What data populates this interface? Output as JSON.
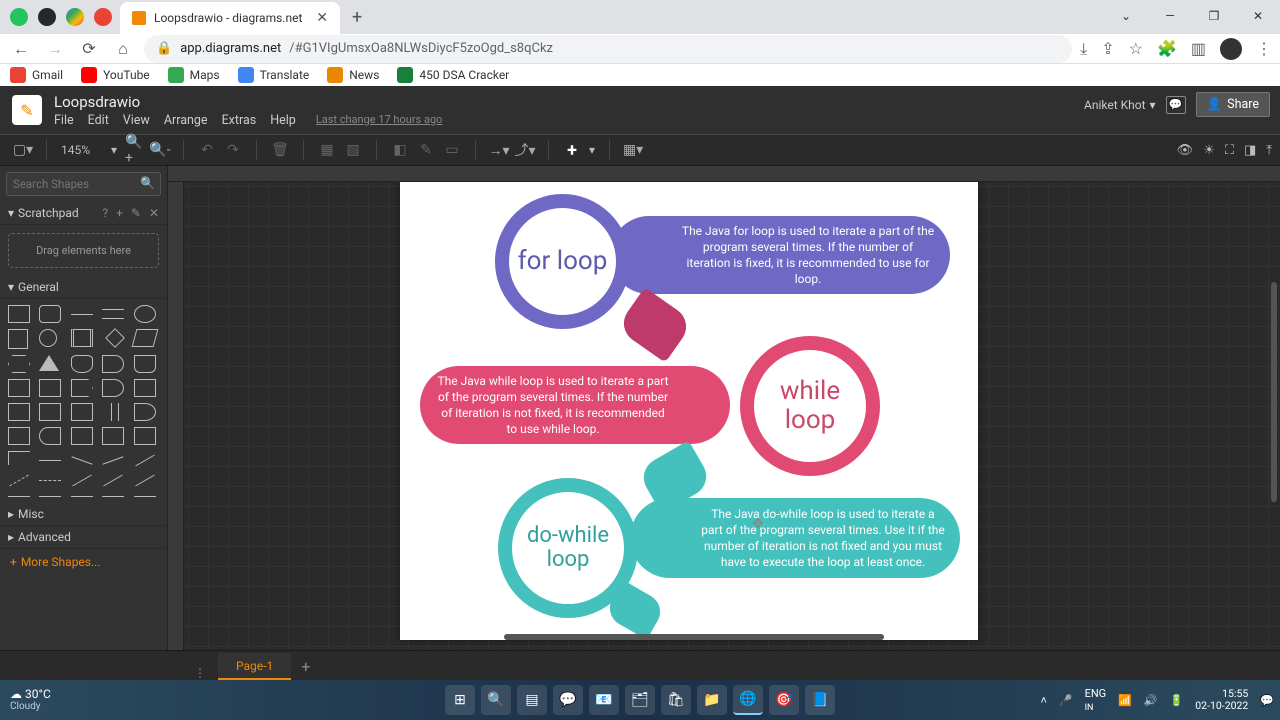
{
  "browser": {
    "tab_title": "Loopsdrawio - diagrams.net",
    "url_host": "app.diagrams.net",
    "url_path": "/#G1VIgUmsxOa8NLWsDiycF5zoOgd_s8qCkz",
    "win_minimize": "—",
    "win_maximize": "❐",
    "win_close": "✕",
    "new_tab": "+",
    "tab_close": "✕",
    "back": "←",
    "forward": "→",
    "reload": "⟳",
    "lock": "🔒"
  },
  "bookmarks": [
    {
      "label": "Gmail",
      "color": "#ea4335"
    },
    {
      "label": "YouTube",
      "color": "#ff0000"
    },
    {
      "label": "Maps",
      "color": "#34a853"
    },
    {
      "label": "Translate",
      "color": "#4285f4"
    },
    {
      "label": "News",
      "color": "#ea8600"
    },
    {
      "label": "450 DSA Cracker",
      "color": "#188038"
    }
  ],
  "app": {
    "doc_title": "Loopsdrawio",
    "menus": [
      "File",
      "Edit",
      "View",
      "Arrange",
      "Extras",
      "Help"
    ],
    "last_change": "Last change 17 hours ago",
    "user": "Aniket Khot",
    "share": "Share",
    "zoom": "145%",
    "search_placeholder": "Search Shapes",
    "scratchpad_title": "Scratchpad",
    "drop_hint": "Drag elements here",
    "section_general": "General",
    "section_misc": "Misc",
    "section_advanced": "Advanced",
    "more_shapes": "More Shapes...",
    "page_tab": "Page-1"
  },
  "diagram": {
    "for_title": "for loop",
    "for_desc": "The Java for loop is used to iterate a part of the program several times. If the number of iteration is fixed, it is recommended to use for loop.",
    "while_title": "while loop",
    "while_desc": "The Java while loop is used to iterate a part of the program several times. If the number of iteration is not fixed, it is recommended to use while loop.",
    "do_title": "do-while loop",
    "do_desc": "The Java do-while loop is used to iterate a part of the program several times. Use it if the number of iteration is not fixed and you must have to execute the loop at least once."
  },
  "taskbar": {
    "temp": "30°C",
    "cond": "Cloudy",
    "lang1": "ENG",
    "lang2": "IN",
    "time": "15:55",
    "date": "02-10-2022"
  }
}
